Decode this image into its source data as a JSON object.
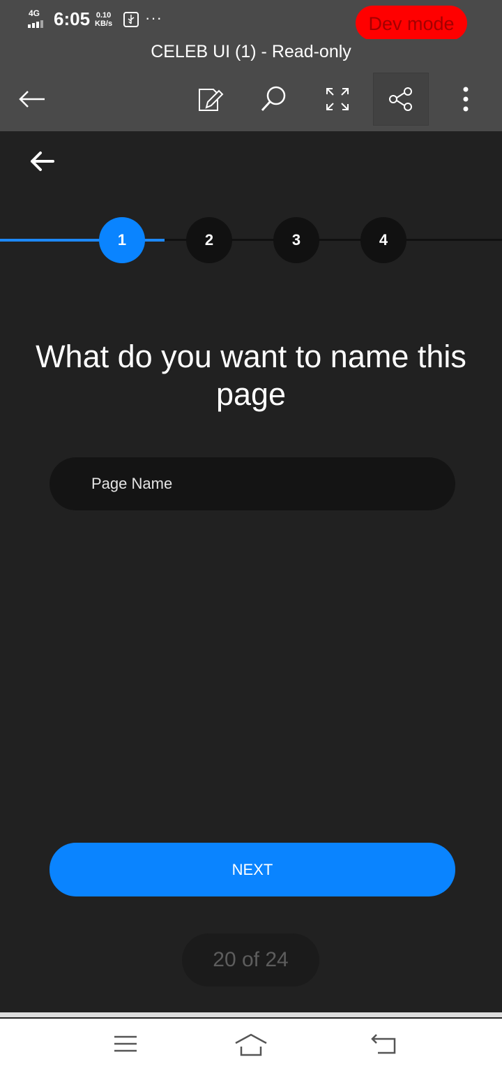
{
  "status_bar": {
    "network": "4G",
    "time": "6:05",
    "speed_value": "0.10",
    "speed_unit": "KB/s",
    "dev_mode_label": "Dev mode",
    "dev_mode_color": "#ff0000"
  },
  "toolbar": {
    "title": "CELEB UI (1) - Read-only",
    "icons": [
      "back-arrow-icon",
      "edit-document-icon",
      "search-icon",
      "expand-icon",
      "share-icon",
      "more-vertical-icon"
    ]
  },
  "app": {
    "steps": [
      {
        "number": "1",
        "active": true
      },
      {
        "number": "2",
        "active": false
      },
      {
        "number": "3",
        "active": false
      },
      {
        "number": "4",
        "active": false
      }
    ],
    "question": "What do you want to name this page",
    "input_placeholder": "Page Name",
    "input_value": "",
    "next_label": "NEXT",
    "page_counter": "20 of 24",
    "accent_color": "#0a84ff"
  },
  "system_nav": {
    "icons": [
      "menu-icon",
      "home-icon",
      "back-icon"
    ]
  }
}
